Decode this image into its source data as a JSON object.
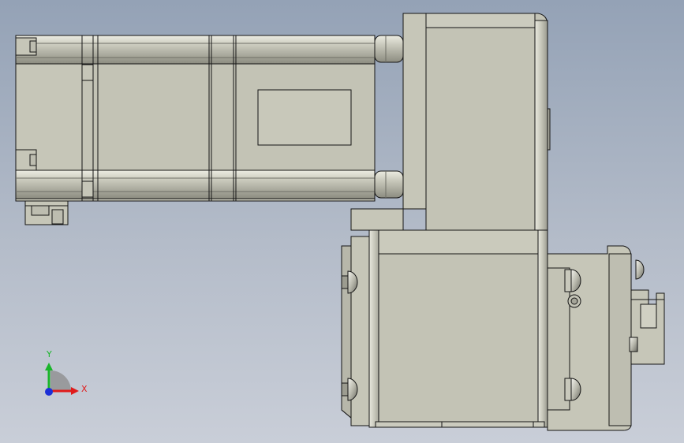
{
  "viewport": {
    "background_top": "#94a2b6",
    "background_bottom": "#c9ced8"
  },
  "model": {
    "part_fill": "#c3c3b5",
    "part_fill_light": "#d4d4c7",
    "part_fill_dark": "#9c9c90",
    "edge_color": "#151515",
    "label_plate_fill": "#c8c8ba"
  },
  "triad": {
    "x_label": "X",
    "y_label": "Y",
    "x_color": "#e01b1b",
    "y_color": "#19b52a",
    "z_color": "#1c2fd6"
  }
}
